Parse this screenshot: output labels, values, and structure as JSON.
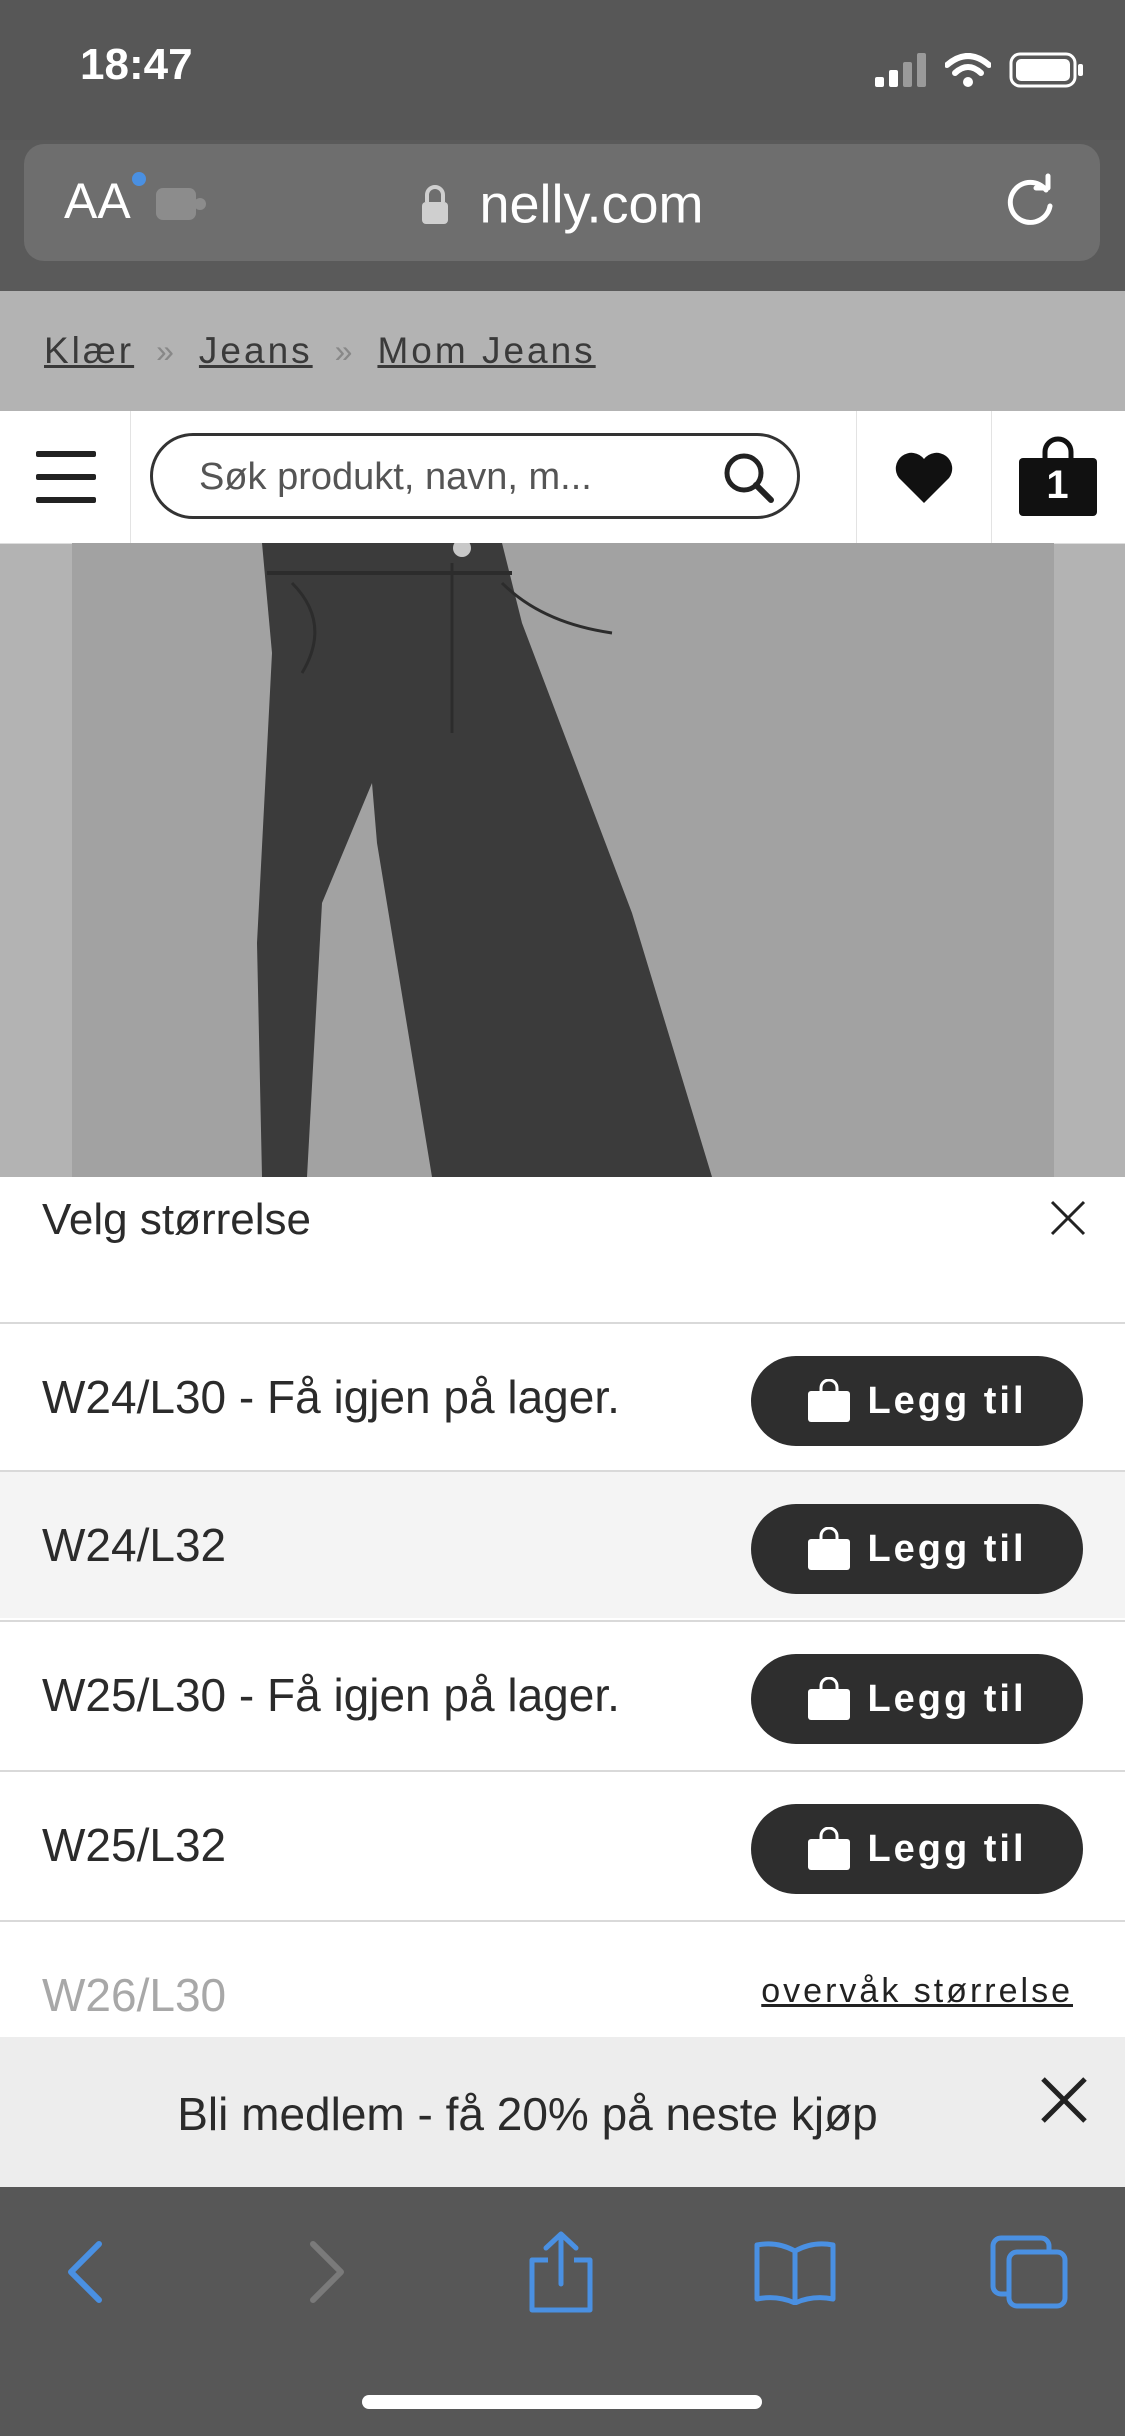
{
  "status_bar": {
    "time": "18:47"
  },
  "browser": {
    "aa_label": "AA",
    "url": "nelly.com"
  },
  "breadcrumb": [
    "Klær",
    "Jeans",
    "Mom Jeans"
  ],
  "breadcrumb_sep": "»",
  "header": {
    "search_placeholder": "Søk produkt, navn, m...",
    "cart_count": "1"
  },
  "sheet": {
    "title": "Velg størrelse",
    "sizes": [
      {
        "label": "W24/L30 - Få igjen på lager.",
        "button": "Legg til"
      },
      {
        "label": "W24/L32",
        "button": "Legg til"
      },
      {
        "label": "W25/L30 - Få igjen på lager.",
        "button": "Legg til"
      },
      {
        "label": "W25/L32",
        "button": "Legg til"
      },
      {
        "label": "W26/L30",
        "link": "overvåk størrelse"
      }
    ]
  },
  "banner": {
    "text": "Bli medlem - få 20% på neste kjøp"
  },
  "colors": {
    "accent_blue": "#4a90e2",
    "button_dark": "#2e2e2e"
  }
}
